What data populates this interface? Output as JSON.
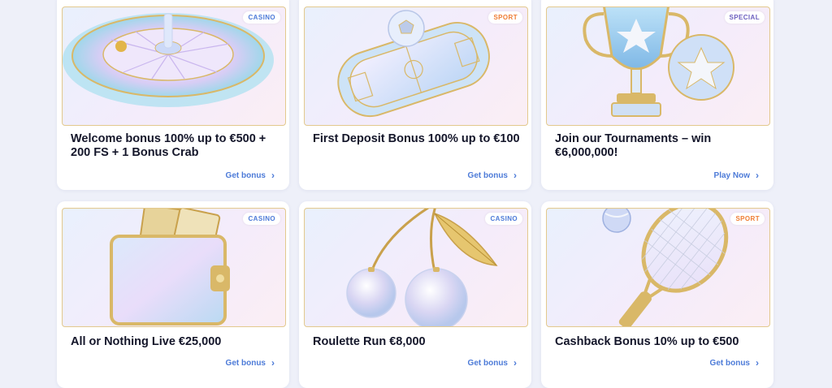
{
  "colors": {
    "page_bg": "#eef0f9",
    "accent_link": "#4d7bd8",
    "badge_casino": "#4d7bd8",
    "badge_sport": "#ef7d34",
    "badge_special": "#6c5fbf",
    "frame_gold": "#e3c98d"
  },
  "cards": [
    {
      "badge": "CASINO",
      "title": "Welcome bonus 100% up to €500 + 200 FS + 1 Bonus Crab",
      "cta": "Get bonus",
      "illustration": "roulette-wheel"
    },
    {
      "badge": "SPORT",
      "title": "First Deposit Bonus 100% up to €100",
      "cta": "Get bonus",
      "illustration": "football-stadium"
    },
    {
      "badge": "SPECIAL",
      "title": "Join our Tournaments – win €6,000,000!",
      "cta": "Play Now",
      "illustration": "trophy-and-ball"
    },
    {
      "badge": "CASINO",
      "title": "All or Nothing Live €25,000",
      "cta": "Get bonus",
      "illustration": "wallet"
    },
    {
      "badge": "CASINO",
      "title": "Roulette Run €8,000",
      "cta": "Get bonus",
      "illustration": "cherries"
    },
    {
      "badge": "SPORT",
      "title": "Cashback Bonus 10% up to €500",
      "cta": "Get bonus",
      "illustration": "tennis-racket"
    }
  ],
  "icons": {
    "cta_chevron": "chevron-right-icon"
  }
}
